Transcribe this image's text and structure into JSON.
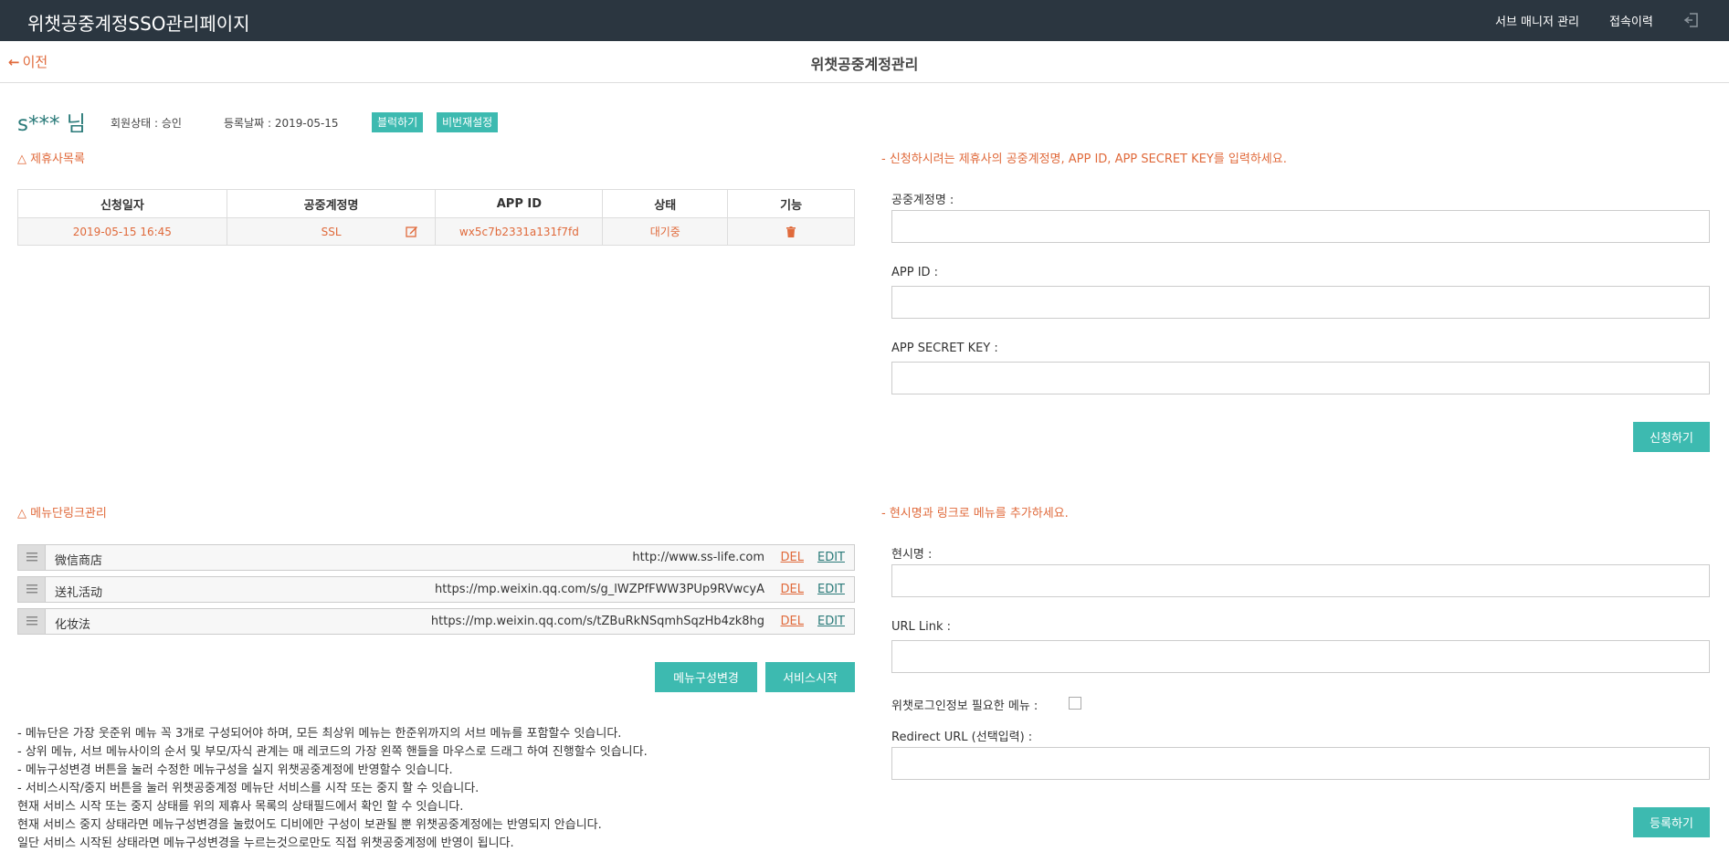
{
  "topbar": {
    "brand": "위챗공중계정SSO관리페이지",
    "nav_sub_manager": "서브 매니저 관리",
    "nav_access_history": "접속이력"
  },
  "subheader": {
    "back_label": "이전",
    "page_title": "위챗공중계정관리"
  },
  "user": {
    "name": "s*** 님",
    "member_status": "회원상태 : 승인",
    "register_date": "등록날짜 : 2019-05-15",
    "block_button": "블럭하기",
    "password_button": "비번재설정"
  },
  "partners": {
    "section_title": "△ 제휴사목록",
    "columns": [
      "신청일자",
      "공중계정명",
      "APP ID",
      "상태",
      "기능"
    ],
    "rows": [
      {
        "date": "2019-05-15 16:45",
        "account": "SSL",
        "app_id": "wx5c7b2331a131f7fd",
        "status": "대기중"
      }
    ]
  },
  "apply_form": {
    "instruction": "- 신청하시려는 제휴사의 공중계정명, APP ID, APP SECRET KEY를 입력하세요.",
    "account_label": "공중계정명 :",
    "app_id_label": "APP ID :",
    "secret_label": "APP SECRET KEY :",
    "submit_label": "신청하기"
  },
  "menu_links": {
    "section_title": "△ 메뉴단링크관리",
    "del_label": "DEL",
    "edit_label": "EDIT",
    "items": [
      {
        "name": "微信商店",
        "url": "http://www.ss-life.com"
      },
      {
        "name": "送礼活动",
        "url": "https://mp.weixin.qq.com/s/g_lWZPfFWW3PUp9RVwcyA"
      },
      {
        "name": "化妆法",
        "url": "https://mp.weixin.qq.com/s/tZBuRkNSqmhSqzHb4zk8hg"
      }
    ],
    "change_button": "메뉴구성변경",
    "start_button": "서비스시작",
    "notes": [
      "- 메뉴단은 가장 웃준위 메뉴 꼭 3개로 구성되어야 하며, 모든 최상위 메뉴는 한준위까지의 서브 메뉴를 포함할수 잇습니다.",
      "- 상위 메뉴, 서브 메뉴사이의 순서 및 부모/자식 관계는 매 레코드의 가장 왼쪽 핸들을 마우스로 드래그 하여 진행할수 잇습니다.",
      "- 메뉴구성변경 버튼을 눌러 수정한 메뉴구성을 실지 위챗공중계정에 반영할수 잇습니다.",
      "- 서비스시작/중지 버튼을 눌러 위챗공중계정 메뉴단 서비스를 시작 또는 중지 할 수 잇습니다.",
      "현재 서비스 시작 또는 중지 상태를 위의 제휴사 목록의 상태필드에서 확인 할 수 잇습니다.",
      "현재 서비스 중지 상태라면 메뉴구성변경을 눌렀어도 디비에만 구성이 보관될 뿐 위챗공중계정에는 반영되지 안습니다.",
      "일단 서비스 시작된 상태라면 메뉴구성변경을 누르는것으로만도 직접 위챗공중계정에 반영이 됩니다."
    ]
  },
  "menu_form": {
    "instruction": "- 현시명과 링크로 메뉴를 추가하세요.",
    "name_label": "현시명 :",
    "url_label": "URL Link :",
    "login_label": "위챗로그인정보 필요한 메뉴 :",
    "redirect_label": "Redirect URL (선택입력) :",
    "submit_label": "등록하기"
  },
  "colors": {
    "topbar": "#2b3640",
    "accent_orange": "#e06a3b",
    "teal": "#3dbab0"
  }
}
